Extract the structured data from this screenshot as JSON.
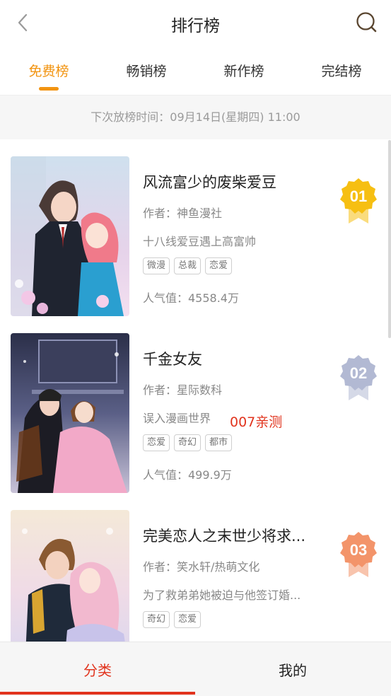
{
  "header": {
    "title": "排行榜",
    "back_icon": "chevron-left-icon",
    "search_icon": "search-icon"
  },
  "tabs": [
    {
      "label": "免费榜",
      "active": true
    },
    {
      "label": "畅销榜",
      "active": false
    },
    {
      "label": "新作榜",
      "active": false
    },
    {
      "label": "完结榜",
      "active": false
    }
  ],
  "schedule": {
    "text": "下次放榜时间：09月14日(星期四) 11:00"
  },
  "items": [
    {
      "title": "风流富少的废柴爱豆",
      "author": "作者：神鱼漫社",
      "desc": "十八线爱豆遇上高富帅",
      "tags": [
        "微漫",
        "总裁",
        "恋爱"
      ],
      "popularity": "人气值：4558.4万",
      "rank": "01",
      "badge_color": "#f6bf12"
    },
    {
      "title": "千金女友",
      "author": "作者：星际数科",
      "desc": "误入漫画世界",
      "tags": [
        "恋爱",
        "奇幻",
        "都市"
      ],
      "popularity": "人气值：499.9万",
      "rank": "02",
      "badge_color": "#b2b9d3"
    },
    {
      "title": "完美恋人之末世少将求...",
      "author": "作者：笑水轩/热萌文化",
      "desc": "为了救弟弟她被迫与他签订婚...",
      "tags": [
        "奇幻",
        "恋爱"
      ],
      "popularity": "",
      "rank": "03",
      "badge_color": "#f3946a"
    }
  ],
  "watermark": "007亲测",
  "tabbar": [
    {
      "label": "分类",
      "active": true
    },
    {
      "label": "我的",
      "active": false
    }
  ],
  "colors": {
    "accent": "#f29411",
    "tabbar_accent": "#e1341e"
  }
}
